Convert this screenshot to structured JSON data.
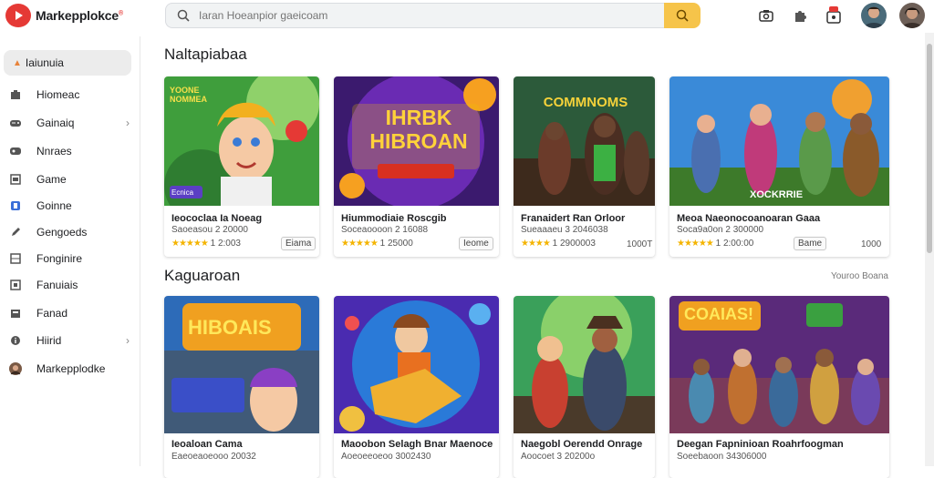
{
  "app": {
    "title": "Markepplokce",
    "badge": "®"
  },
  "search": {
    "placeholder": "Iaran Hoeanpior gaeicoam"
  },
  "sidebar": {
    "active_label": "Iaiunuia",
    "items": [
      {
        "label": "Hiomeac",
        "icon": "home-icon",
        "chevron": false
      },
      {
        "label": "Gainaiq",
        "icon": "gamepad-icon",
        "chevron": true
      },
      {
        "label": "Nnraes",
        "icon": "news-icon",
        "chevron": false
      },
      {
        "label": "Game",
        "icon": "game-icon",
        "chevron": false
      },
      {
        "label": "Goinne",
        "icon": "shield-icon",
        "chevron": false
      },
      {
        "label": "Gengoeds",
        "icon": "pen-icon",
        "chevron": false
      },
      {
        "label": "Fonginire",
        "icon": "grid-icon",
        "chevron": false
      },
      {
        "label": "Fanuiais",
        "icon": "box-icon",
        "chevron": false
      },
      {
        "label": "Fanad",
        "icon": "folder-icon",
        "chevron": false
      },
      {
        "label": "Hiirid",
        "icon": "info-icon",
        "chevron": true
      },
      {
        "label": "Markepplodke",
        "icon": "avatar-icon",
        "chevron": false
      }
    ]
  },
  "sections": [
    {
      "title": "Naltapiabaa",
      "view_more": "",
      "cards": [
        {
          "title": "Ieococlaa Ia Noeag",
          "rating_text": "Saoeasou 2 20000",
          "stars": "★★★★★",
          "stat": "1 2:003",
          "tag": "Eiama",
          "count": "",
          "badge": "Ecnica",
          "art_text": "YOONE NOMMEA"
        },
        {
          "title": "Hiummodiaie Roscgib",
          "rating_text": "Soceaoooon 2 16088",
          "stars": "★★★★★",
          "stat": "1 25000",
          "tag": "Ieome",
          "count": "",
          "badge": "",
          "art_text": "IHRBK HIBROAN"
        },
        {
          "title": "Franaidert Ran Orloor",
          "rating_text": "Sueaaaeu 3 2046038",
          "stars": "★★★★",
          "stat": "1 2900003",
          "tag": "",
          "count": "1000T",
          "badge": "",
          "art_text": "COMMNOMS"
        },
        {
          "title": "Meoa Naeonocoanoaran Gaaa",
          "rating_text": "Soca9a0on 2 300000",
          "stars": "★★★★★",
          "stat": "1 2:00:00",
          "tag": "Bame",
          "count": "1000",
          "badge": "",
          "art_text": "XOCKRRIE"
        }
      ]
    },
    {
      "title": "Kaguaroan",
      "view_more": "Youroo Boana",
      "cards": [
        {
          "title": "Ieoaloan Cama",
          "rating_text": "Eaeoeaoeooo 20032",
          "stars": "",
          "stat": "",
          "tag": "",
          "count": "",
          "badge": "",
          "art_text": "HIBOAIS"
        },
        {
          "title": "Maoobon Selagh Bnar Maenoce",
          "rating_text": "Aoeoeeoeoo 3002430",
          "stars": "",
          "stat": "",
          "tag": "",
          "count": "",
          "badge": "",
          "art_text": ""
        },
        {
          "title": "Naegobl Oerendd Onrage",
          "rating_text": "Aoocoet 3 20200o",
          "stars": "",
          "stat": "",
          "tag": "",
          "count": "",
          "badge": "",
          "art_text": ""
        },
        {
          "title": "Deegan Fapninioan Roahrfoogman",
          "rating_text": "Soeebaoon 34306000",
          "stars": "",
          "stat": "",
          "tag": "",
          "count": "",
          "badge": "",
          "art_text": "COAIAS!"
        }
      ]
    }
  ],
  "colors": {
    "accent": "#f6c44a",
    "brand": "#e53935",
    "star": "#f4b400"
  }
}
